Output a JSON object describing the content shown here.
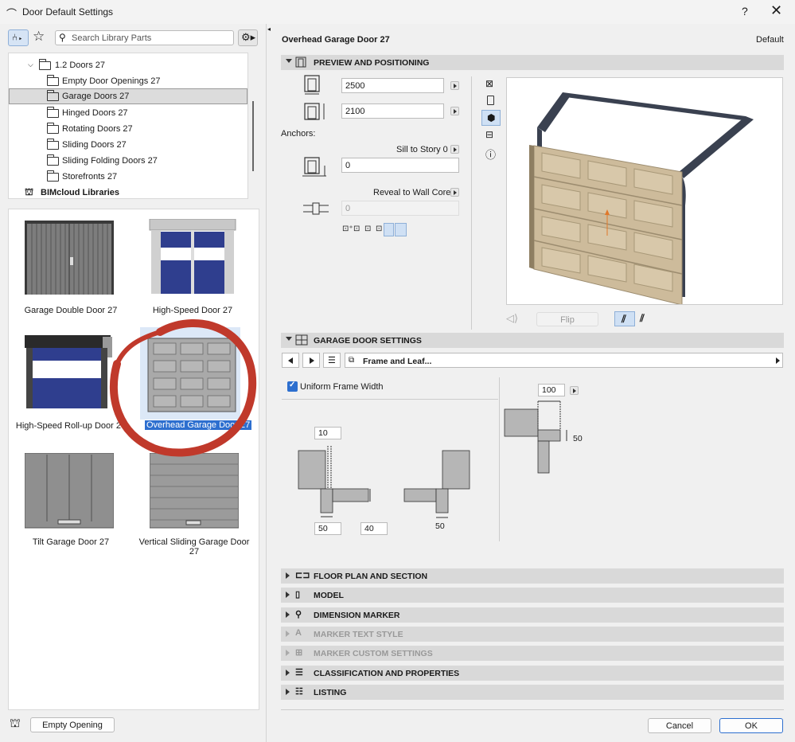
{
  "window": {
    "title": "Door Default Settings",
    "help": "?",
    "close": "✕"
  },
  "search": {
    "placeholder": "Search Library Parts"
  },
  "tree": {
    "items": [
      {
        "label": "1.2 Doors 27"
      },
      {
        "label": "Empty Door Openings 27"
      },
      {
        "label": "Garage Doors 27"
      },
      {
        "label": "Hinged Doors 27"
      },
      {
        "label": "Rotating Doors 27"
      },
      {
        "label": "Sliding Doors 27"
      },
      {
        "label": "Sliding Folding Doors 27"
      },
      {
        "label": "Storefronts 27"
      },
      {
        "label": "BIMcloud Libraries"
      }
    ]
  },
  "gallery": {
    "items": [
      {
        "label": "Garage Double Door 27"
      },
      {
        "label": "High-Speed Door 27"
      },
      {
        "label": "High-Speed Roll-up Door 27"
      },
      {
        "label": "Overhead Garage Door 27"
      },
      {
        "label": "Tilt Garage Door 27"
      },
      {
        "label": "Vertical Sliding Garage Door 27"
      }
    ]
  },
  "bottom_left": {
    "empty_opening": "Empty Opening"
  },
  "header": {
    "object_name": "Overhead Garage Door 27",
    "default_label": "Default"
  },
  "preview": {
    "section_title": "PREVIEW AND POSITIONING",
    "width": "2500",
    "height": "2100",
    "anchors_label": "Anchors:",
    "sill_label": "Sill to Story 0",
    "sill_value": "0",
    "reveal_label": "Reveal to Wall Core",
    "reveal_value": "0",
    "flip_label": "Flip"
  },
  "garage": {
    "section_title": "GARAGE DOOR SETTINGS",
    "page_select": "Frame and Leaf...",
    "uniform_frame": "Uniform Frame Width",
    "dim_10": "10",
    "dim_50a": "50",
    "dim_40": "40",
    "dim_50b": "50",
    "dim_100": "100",
    "dim_50c": "50"
  },
  "sections": [
    {
      "label": "FLOOR PLAN AND SECTION"
    },
    {
      "label": "MODEL"
    },
    {
      "label": "DIMENSION MARKER"
    },
    {
      "label": "MARKER TEXT STYLE"
    },
    {
      "label": "MARKER CUSTOM SETTINGS"
    },
    {
      "label": "CLASSIFICATION AND PROPERTIES"
    },
    {
      "label": "LISTING"
    }
  ],
  "footer": {
    "cancel": "Cancel",
    "ok": "OK"
  },
  "colors": {
    "accent": "#2d6fcf",
    "highlight_circle": "#c0392b",
    "door_panel": "#cdbb9b",
    "selection": "#2d6fcf"
  }
}
